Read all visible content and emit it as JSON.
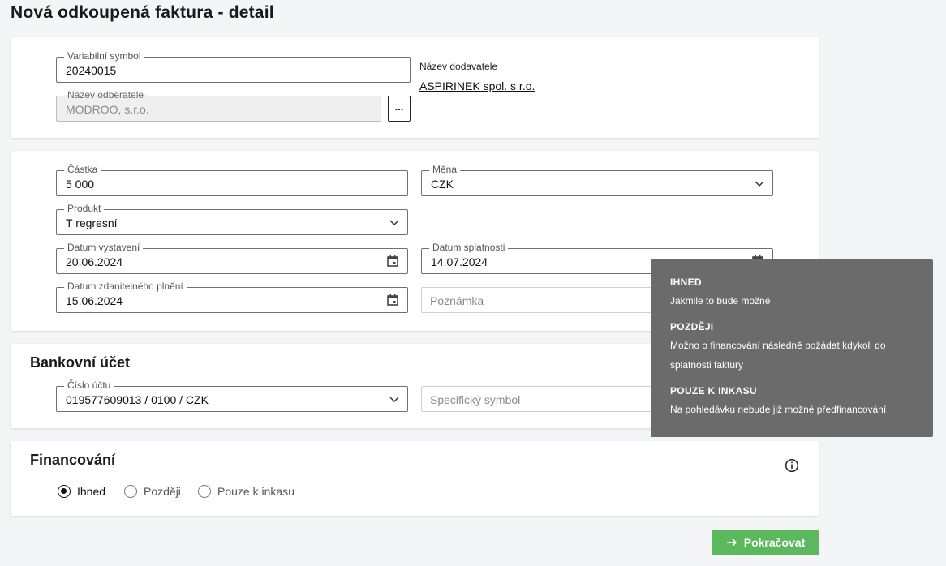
{
  "page": {
    "title": "Nová odkoupená faktura - detail"
  },
  "invoice": {
    "variable_symbol": {
      "label": "Variabilní symbol",
      "value": "20240015"
    },
    "customer_name": {
      "label": "Název odběratele",
      "value": "MODROO, s.r.o."
    },
    "more_button": "...",
    "supplier": {
      "label": "Název dodavatele",
      "value": "ASPIRINEK spol. s r.o."
    }
  },
  "details": {
    "amount": {
      "label": "Částka",
      "value": "5 000"
    },
    "currency": {
      "label": "Měna",
      "value": "CZK"
    },
    "product": {
      "label": "Produkt",
      "value": "T regresní"
    },
    "issue_date": {
      "label": "Datum vystavení",
      "value": "20.06.2024"
    },
    "due_date": {
      "label": "Datum splatnosti",
      "value": "14.07.2024"
    },
    "taxable_date": {
      "label": "Datum zdanitelného plnění",
      "value": "15.06.2024"
    },
    "note": {
      "placeholder": "Poznámka"
    }
  },
  "bank": {
    "title": "Bankovní účet",
    "account": {
      "label": "Číslo účtu",
      "value": "019577609013 / 0100 / CZK"
    },
    "specific_symbol": {
      "placeholder": "Specifický symbol"
    }
  },
  "financing": {
    "title": "Financování",
    "options": [
      "Ihned",
      "Později",
      "Pouze k inkasu"
    ],
    "selected": "Ihned"
  },
  "tooltip": {
    "items": [
      {
        "head": "IHNED",
        "text": "Jakmile to bude možné"
      },
      {
        "head": "POZDĚJI",
        "text": "Možno o financování následně požádat kdykoli do splatnosti faktury"
      },
      {
        "head": "POUZE K INKASU",
        "text": "Na pohledávku nebude již možné předfinancování"
      }
    ]
  },
  "actions": {
    "continue_label": "Pokračovat"
  },
  "colors": {
    "primary_button": "#5cb85c",
    "tooltip_bg": "#6b6b6b",
    "page_bg": "#f4f5f7"
  }
}
